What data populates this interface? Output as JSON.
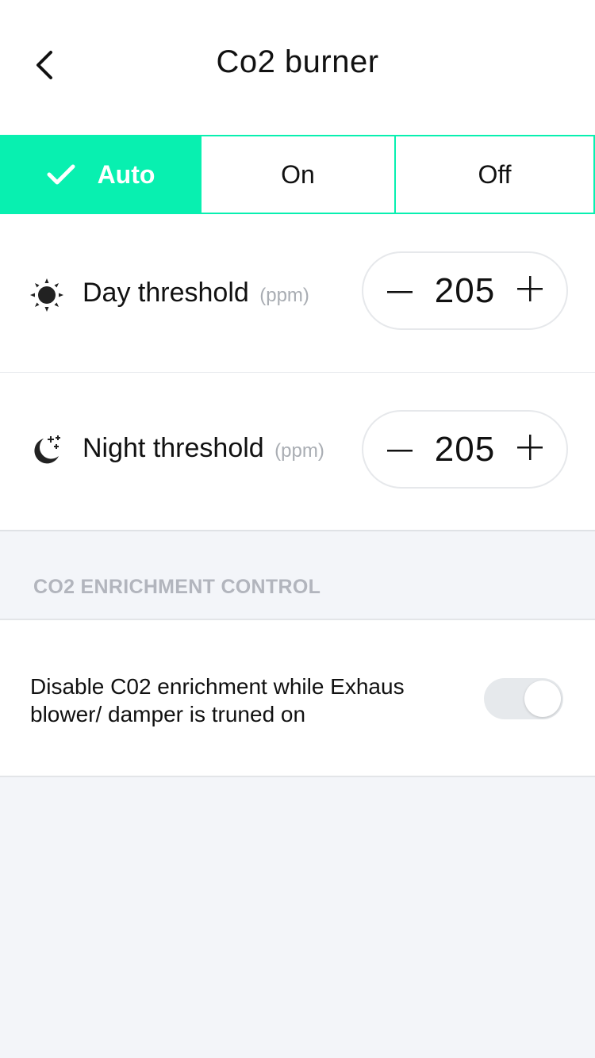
{
  "header": {
    "title": "Co2 burner",
    "back_icon": "chevron-left-icon"
  },
  "mode": {
    "options": [
      "Auto",
      "On",
      "Off"
    ],
    "selected": "Auto",
    "accent_color": "#08f0b0"
  },
  "day": {
    "icon": "sun-icon",
    "label": "Day threshold",
    "unit": "(ppm)",
    "value": "205"
  },
  "night": {
    "icon": "moon-stars-icon",
    "label": "Night threshold",
    "unit": "(ppm)",
    "value": "205"
  },
  "enrichment": {
    "section_title": "CO2 ENRICHMENT CONTROL",
    "toggle_text_line1": "Disable C02 enrichment while Exhaus",
    "toggle_text_line2": "blower/ damper is truned on",
    "toggle_on": false
  }
}
